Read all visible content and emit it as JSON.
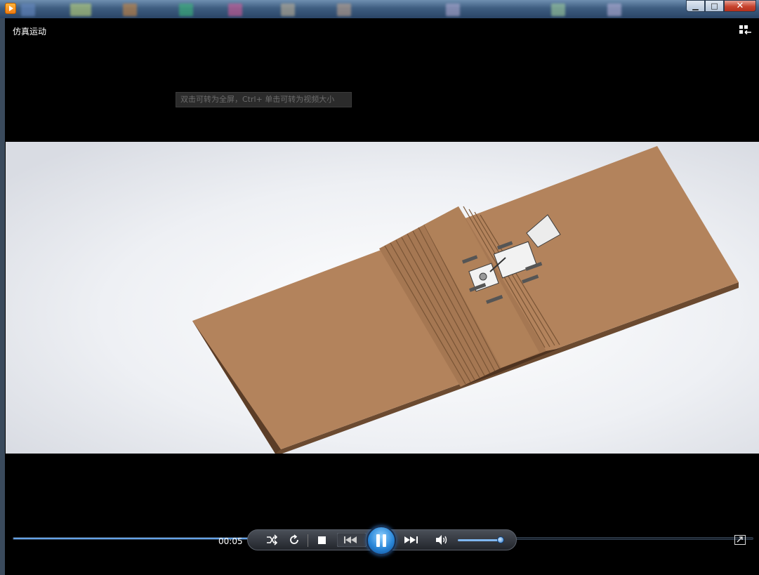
{
  "window": {
    "minimize_label": "▁",
    "maximize_label": "□",
    "close_label": "✕"
  },
  "player": {
    "title": "仿真运动",
    "hint": "双击可转为全屏，Ctrl+ 单击可转为视频大小"
  },
  "controls": {
    "time": "00:05",
    "progress_fraction": 0.465,
    "volume_fraction": 0.95
  },
  "icons": [
    "app-icon",
    "layout-toggle-icon",
    "shuffle-icon",
    "repeat-icon",
    "stop-icon",
    "previous-icon",
    "pause-icon",
    "next-icon",
    "volume-icon",
    "fullscreen-icon"
  ],
  "colors": {
    "accent": "#3a7fd0",
    "board": "#b3835c"
  }
}
